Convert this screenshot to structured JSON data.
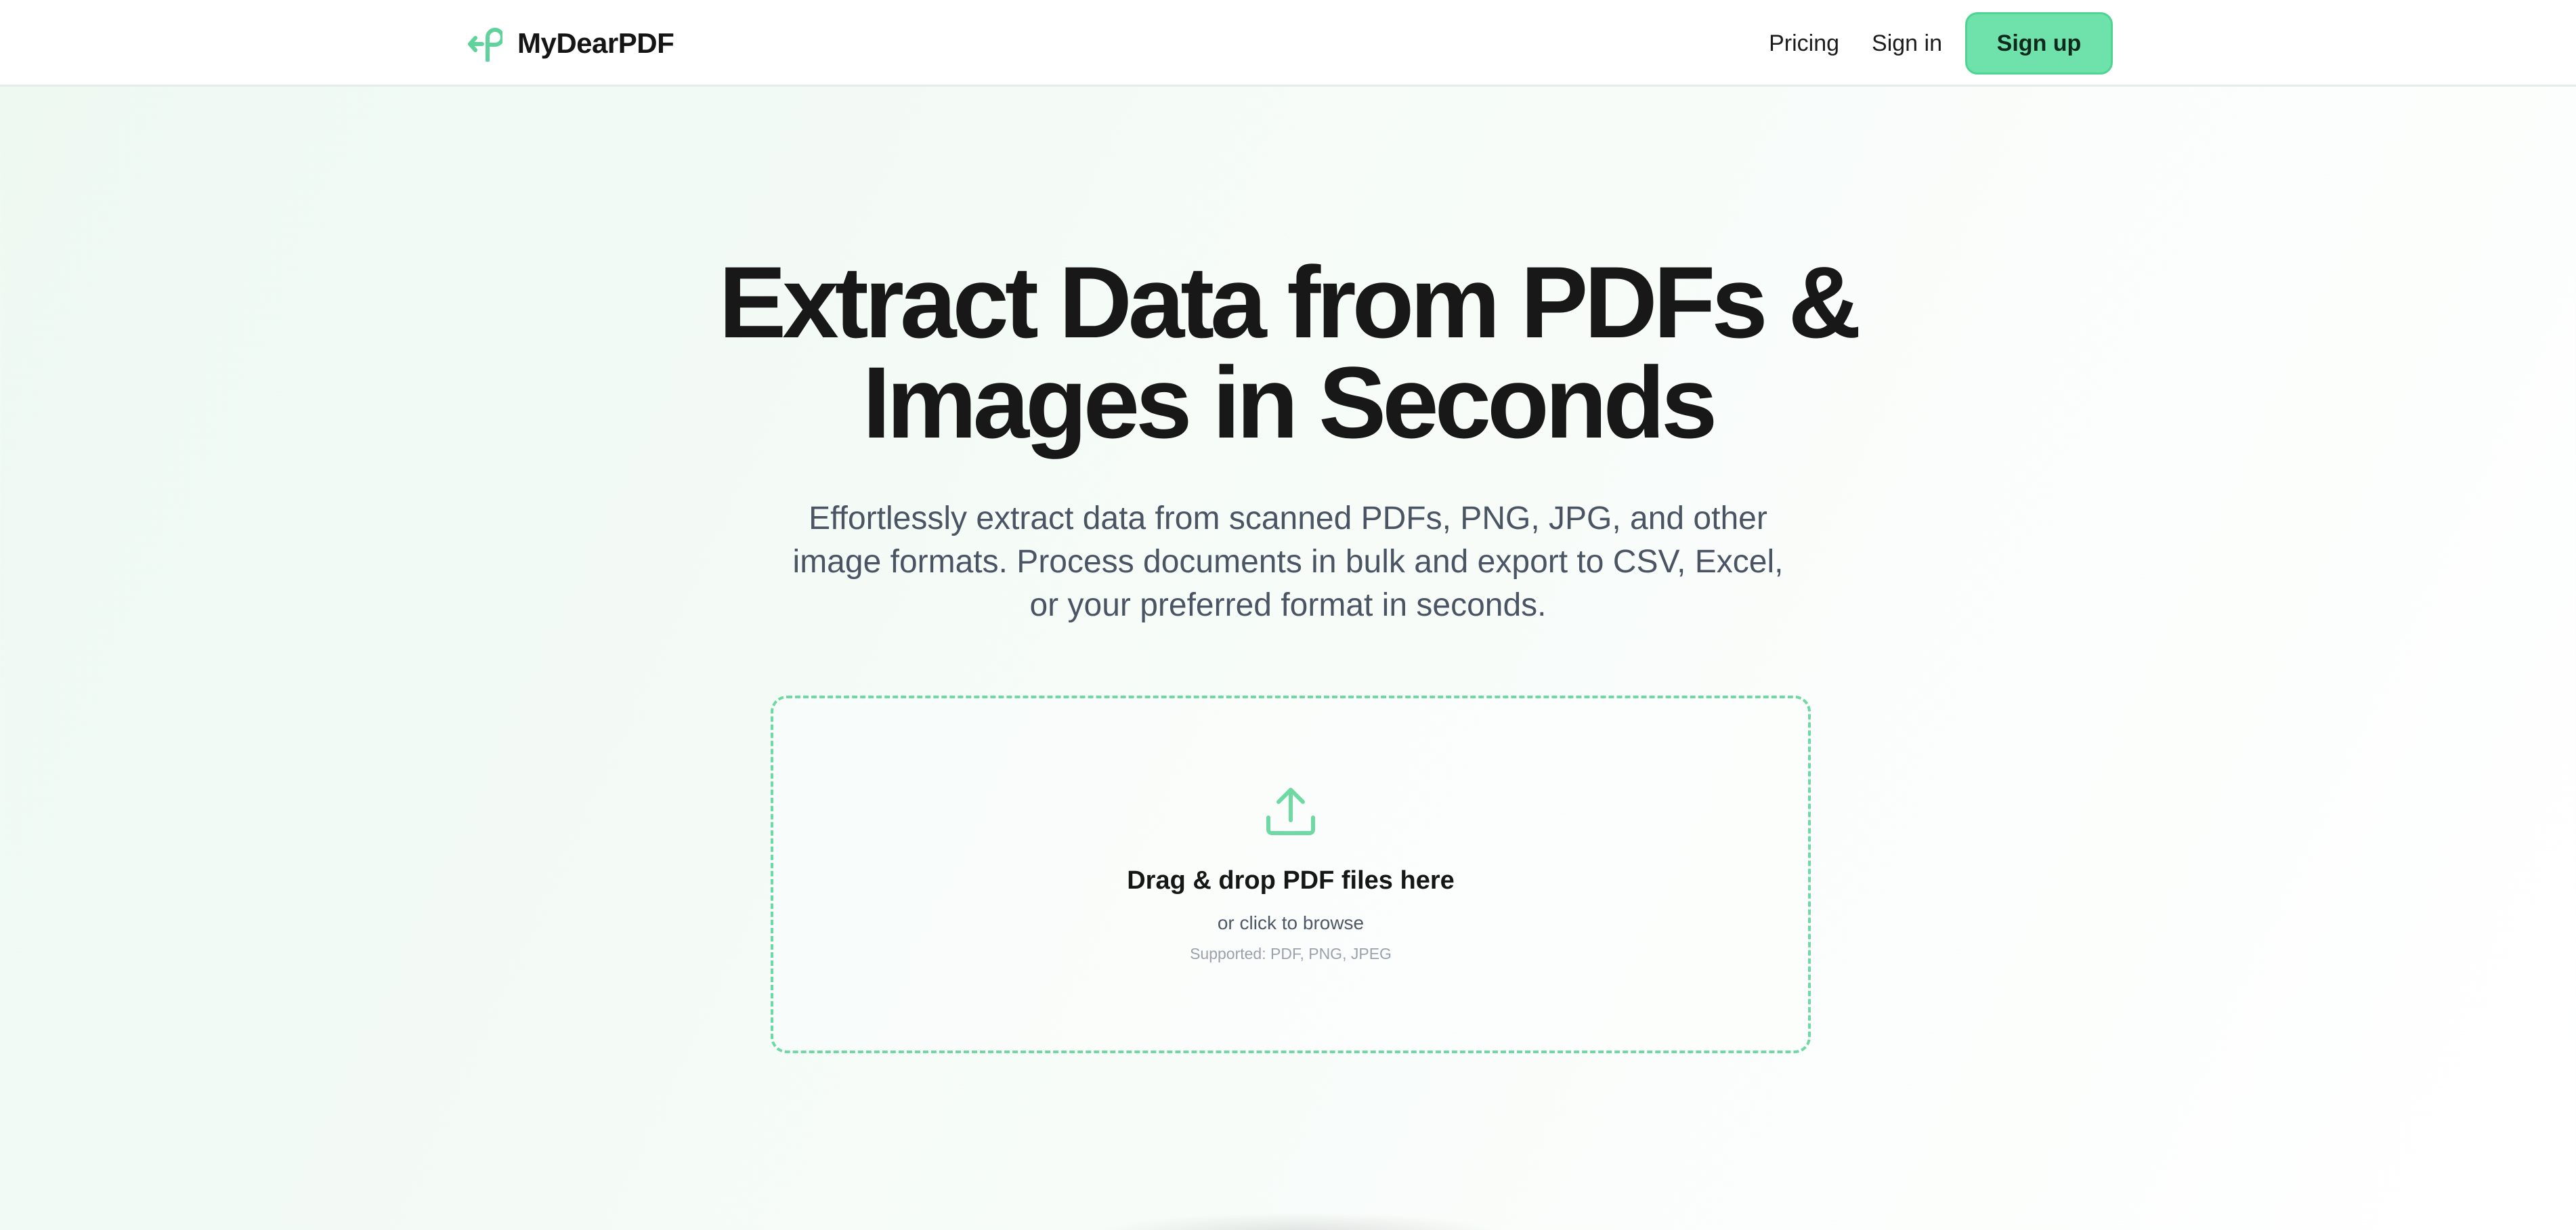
{
  "header": {
    "brand_name": "MyDearPDF",
    "nav": {
      "pricing": "Pricing",
      "sign_in": "Sign in",
      "sign_up": "Sign up"
    }
  },
  "hero": {
    "title_line1": "Extract Data from PDFs &",
    "title_line2": "Images in Seconds",
    "subtitle_line1": "Effortlessly extract data from scanned PDFs, PNG, JPG, and other",
    "subtitle_line2": "image formats. Process documents in bulk and export to CSV, Excel,",
    "subtitle_line3": "or your preferred format in seconds."
  },
  "upload": {
    "icon": "upload-icon",
    "title": "Drag & drop PDF files here",
    "browse": "or click to browse",
    "supported": "Supported: PDF, PNG, JPEG"
  },
  "colors": {
    "accent": "#6ee2aa",
    "accent_border": "#4fd493",
    "dropzone_border": "#6fd9a4",
    "title": "#181818",
    "subtitle": "#4a5463"
  }
}
